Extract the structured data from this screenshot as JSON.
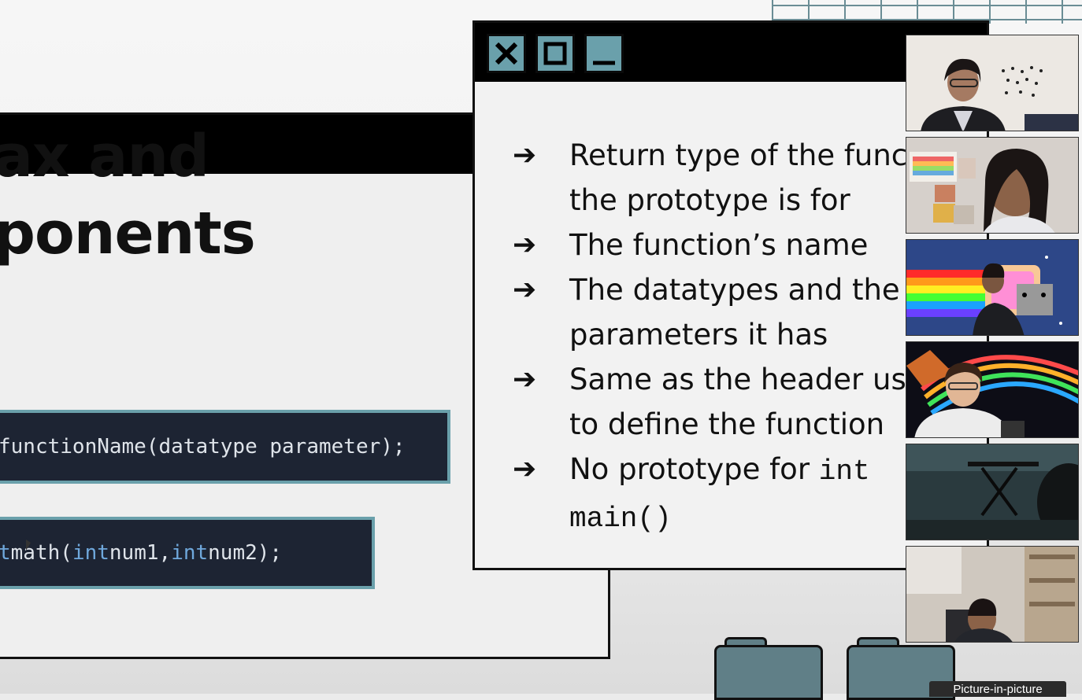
{
  "slide": {
    "title_line1": "ax and",
    "title_line2": "ponents",
    "code_syntax": {
      "text": "functionName(datatype parameter);"
    },
    "code_example": {
      "prefix": "t ",
      "name": "math(",
      "kw1": "int",
      "arg1": " num1, ",
      "kw2": "int",
      "arg2": " num2);"
    }
  },
  "window": {
    "close_label": "✕",
    "bullets": [
      {
        "line1": "Return type of the func",
        "line2": "the prototype is for"
      },
      {
        "line1": "The function’s name"
      },
      {
        "line1": "The datatypes and the",
        "line2": "parameters it has"
      },
      {
        "line1": "Same as the header us",
        "line2": "to define the function"
      },
      {
        "line1": "No prototype for ",
        "code1": "int",
        "code2": "main()"
      }
    ],
    "arrow_glyph": "➔"
  },
  "participants": {
    "tiles": [
      {
        "icon": "participant-video-1"
      },
      {
        "icon": "participant-video-2"
      },
      {
        "icon": "participant-video-3"
      },
      {
        "icon": "participant-video-4"
      },
      {
        "icon": "participant-video-5"
      },
      {
        "icon": "participant-video-6"
      }
    ]
  },
  "overlay": {
    "pip_label": "Picture-in-picture"
  },
  "colors": {
    "accent_teal": "#6aa0ab",
    "code_bg": "#1d2433",
    "keyword": "#6fa8dc"
  }
}
